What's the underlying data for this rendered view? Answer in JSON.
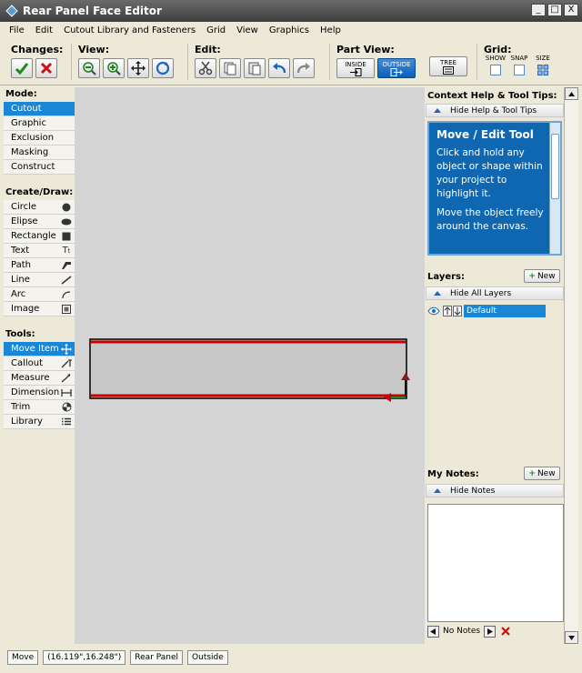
{
  "window": {
    "title": "Rear Panel Face Editor",
    "controls": [
      "_",
      "□",
      "X"
    ]
  },
  "menu": [
    "File",
    "Edit",
    "Cutout Library and Fasteners",
    "Grid",
    "View",
    "Graphics",
    "Help"
  ],
  "toolbar": {
    "changes_label": "Changes:",
    "view_label": "View:",
    "edit_label": "Edit:",
    "partview_label": "Part View:",
    "inside_label": "INSIDE",
    "outside_label": "OUTSIDE",
    "tree_label": "TREE",
    "grid_label": "Grid:",
    "grid_show": "SHOW",
    "grid_snap": "SNAP",
    "grid_size": "SIZE"
  },
  "left": {
    "mode_title": "Mode:",
    "modes": [
      "Cutout",
      "Graphic",
      "Exclusion",
      "Masking",
      "Construct"
    ],
    "create_title": "Create/Draw:",
    "create": [
      "Circle",
      "Elipse",
      "Rectangle",
      "Text",
      "Path",
      "Line",
      "Arc",
      "Image"
    ],
    "tools_title": "Tools:",
    "tools": [
      "Move Item",
      "Callout",
      "Measure",
      "Dimension",
      "Trim",
      "Library"
    ],
    "icons": {
      "Circle": "circle-icon",
      "Elipse": "ellipse-icon",
      "Rectangle": "rectangle-icon",
      "Text": "text-icon",
      "Path": "path-icon",
      "Line": "line-icon",
      "Arc": "arc-icon",
      "Image": "image-icon",
      "Move Item": "move-icon",
      "Callout": "callout-icon",
      "Measure": "measure-icon",
      "Dimension": "dimension-icon",
      "Trim": "trim-icon",
      "Library": "library-icon"
    }
  },
  "right": {
    "help_title": "Context Help & Tool Tips:",
    "hide_help": "Hide Help & Tool Tips",
    "help_heading": "Move / Edit Tool",
    "help_p1": "Click and hold any object or shape within your project to highlight it.",
    "help_p2": "Move the object freely around the canvas.",
    "layers_title": "Layers:",
    "new_label": "New",
    "hide_layers": "Hide All Layers",
    "layer_name": "Default",
    "notes_title": "My Notes:",
    "hide_notes": "Hide Notes",
    "notes_count": "No Notes"
  },
  "status": {
    "tool": "Move",
    "coords": "(16.119\",16.248\")",
    "part": "Rear Panel",
    "view": "Outside"
  },
  "colors": {
    "selection_blue": "#1a86d6",
    "panel_outline_red": "#cc0000",
    "accept_green": "#1b8a1b",
    "cancel_red": "#cc1111"
  }
}
